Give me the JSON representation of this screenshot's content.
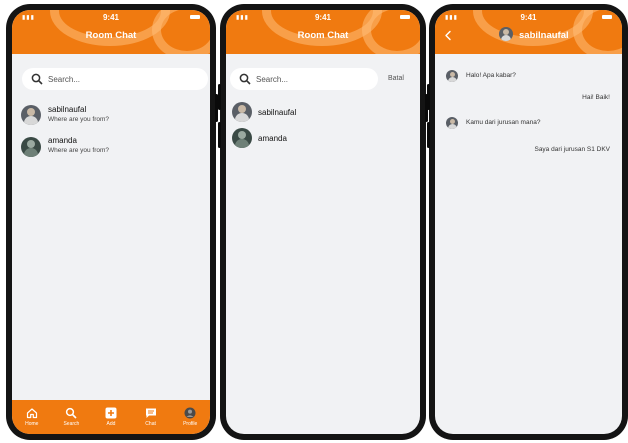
{
  "colors": {
    "brand": "#f07a10",
    "screen_bg": "#f1f2f4",
    "text": "#111111"
  },
  "status_bar": {
    "time": "9:41"
  },
  "screen1": {
    "title": "Room Chat",
    "search": {
      "placeholder": "Search...",
      "icon": "search-icon"
    },
    "contacts": [
      {
        "name": "sabilnaufal",
        "message": "Where are you from?"
      },
      {
        "name": "amanda",
        "message": "Where are you from?"
      }
    ],
    "nav": [
      {
        "label": "Home",
        "icon": "home-icon"
      },
      {
        "label": "Search",
        "icon": "search-icon"
      },
      {
        "label": "Add",
        "icon": "add-icon"
      },
      {
        "label": "Chat",
        "icon": "chat-icon"
      },
      {
        "label": "Profile",
        "icon": "profile-icon"
      }
    ]
  },
  "screen2": {
    "title": "Room Chat",
    "search": {
      "placeholder": "Search...",
      "icon": "search-icon"
    },
    "cancel_label": "Batal",
    "contacts": [
      {
        "name": "sabilnaufal"
      },
      {
        "name": "amanda"
      }
    ]
  },
  "screen3": {
    "title": "sabilnaufal",
    "back_icon": "back-arrow-icon",
    "messages": [
      {
        "side": "left",
        "text": "Halo! Apa kabar?"
      },
      {
        "side": "right",
        "text": "Hai! Baik!"
      },
      {
        "side": "left",
        "text": "Kamu dari jurusan mana?"
      },
      {
        "side": "right",
        "text": "Saya dari jurusan S1 DKV"
      }
    ]
  }
}
